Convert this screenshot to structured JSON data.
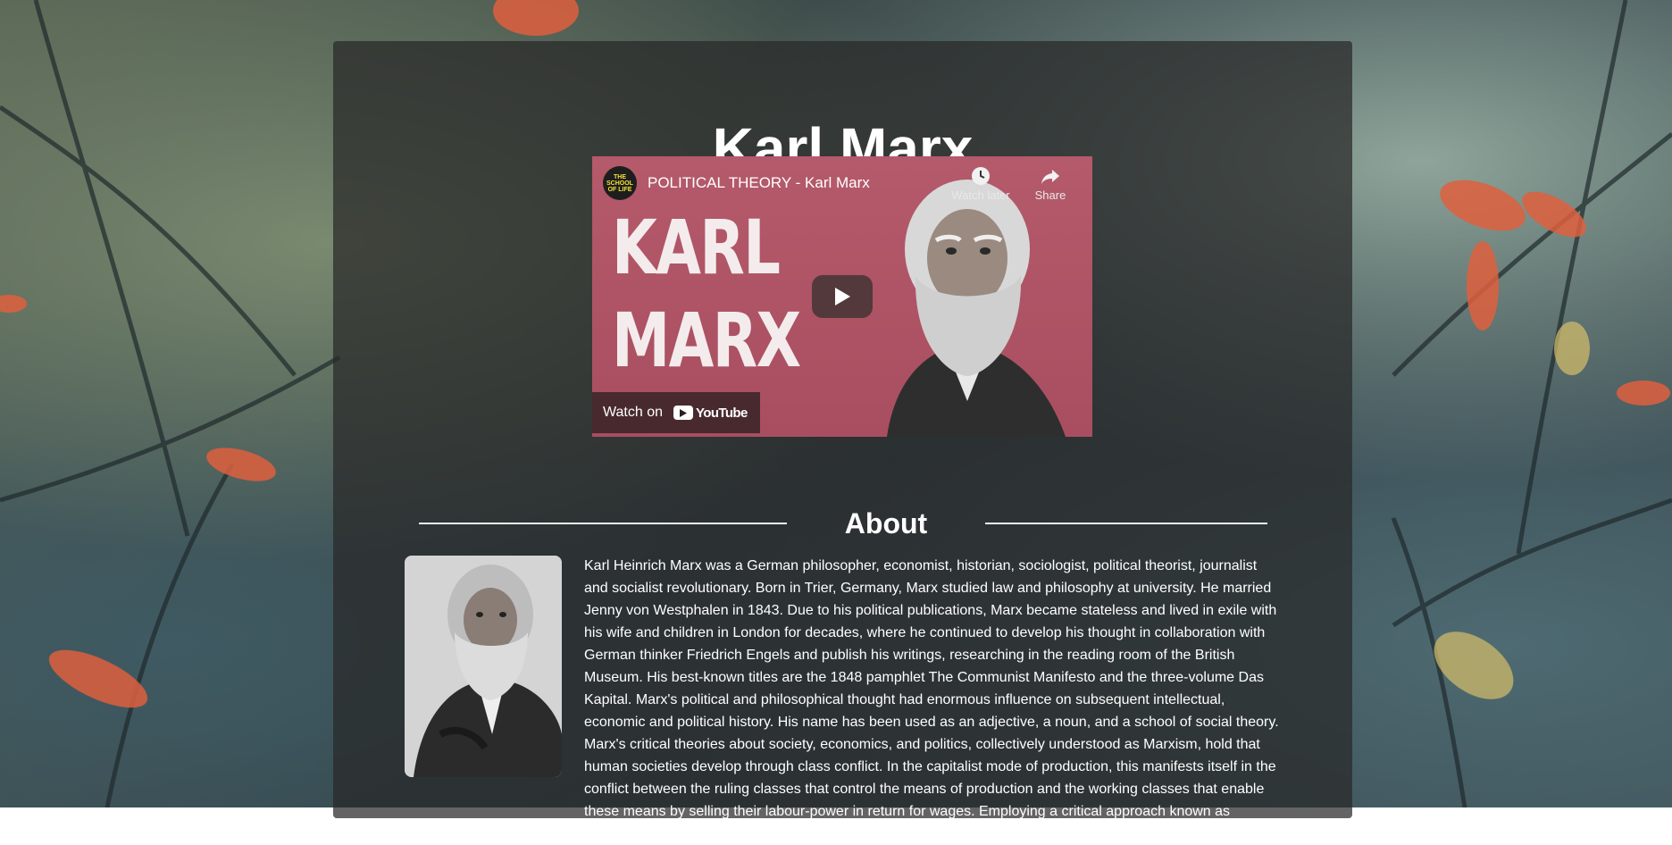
{
  "page": {
    "title": "Karl Marx"
  },
  "video": {
    "channel_avatar_text": "THE SCHOOL OF LIFE",
    "title": "POLITICAL THEORY - Karl Marx",
    "thumbnail_line1": "KARL",
    "thumbnail_line2": "MARX",
    "watch_later_label": "Watch later",
    "share_label": "Share",
    "watch_on_label": "Watch on",
    "youtube_logo_text": "YouTube",
    "accent_color": "#b45a6b"
  },
  "about": {
    "heading": "About",
    "bio": "Karl Heinrich Marx was a German philosopher, economist, historian, sociologist, political theorist, journalist and socialist revolutionary. Born in Trier, Germany, Marx studied law and philosophy at university. He married Jenny von Westphalen in 1843. Due to his political publications, Marx became stateless and lived in exile with his wife and children in London for decades, where he continued to develop his thought in collaboration with German thinker Friedrich Engels and publish his writings, researching in the reading room of the British Museum. His best-known titles are the 1848 pamphlet The Communist Manifesto and the three-volume Das Kapital. Marx's political and philosophical thought had enormous influence on subsequent intellectual, economic and political history. His name has been used as an adjective, a noun, and a school of social theory. Marx's critical theories about society, economics, and politics, collectively understood as Marxism, hold that human societies develop through class conflict. In the capitalist mode of production, this manifests itself in the conflict between the ruling classes that control the means of production and the working classes that enable these means by selling their labour-power in return for wages. Employing a critical approach known as historical materialism, Marx predicted that capitalism produced internal tensions like previous socioeconomic"
  }
}
